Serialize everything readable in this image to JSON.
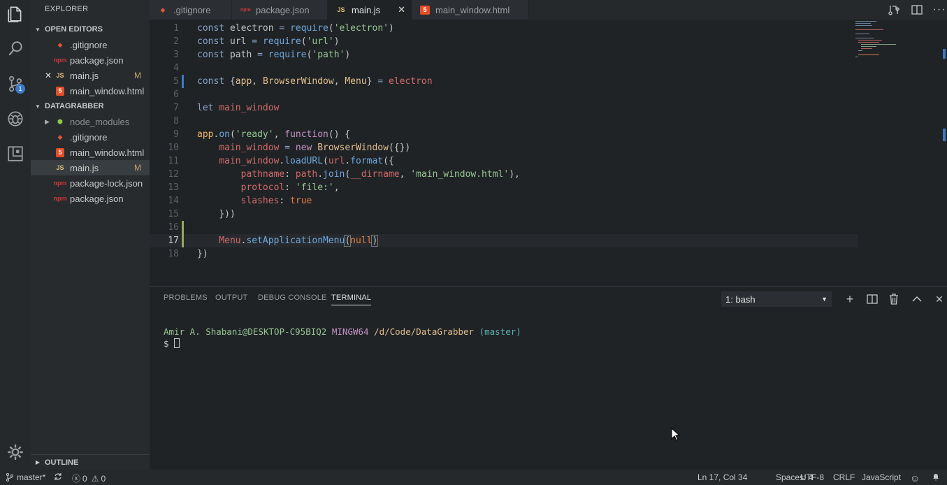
{
  "activity": {
    "items": [
      "files-icon",
      "search-icon",
      "source-control-icon",
      "debug-icon",
      "extensions-icon"
    ],
    "scm_badge": "1",
    "settings": "gear-icon"
  },
  "explorer": {
    "title": "EXPLORER",
    "open_editors": {
      "label": "OPEN EDITORS",
      "items": [
        {
          "name": ".gitignore",
          "icon": "git",
          "modified": ""
        },
        {
          "name": "package.json",
          "icon": "npm",
          "modified": ""
        },
        {
          "name": "main.js",
          "icon": "js",
          "modified": "M"
        },
        {
          "name": "main_window.html",
          "icon": "html",
          "modified": ""
        }
      ]
    },
    "project": {
      "label": "DATAGRABBER",
      "items": [
        {
          "name": "node_modules",
          "icon": "node",
          "modified": ""
        },
        {
          "name": ".gitignore",
          "icon": "git",
          "modified": ""
        },
        {
          "name": "main_window.html",
          "icon": "html",
          "modified": ""
        },
        {
          "name": "main.js",
          "icon": "js",
          "modified": "M"
        },
        {
          "name": "package-lock.json",
          "icon": "npm",
          "modified": ""
        },
        {
          "name": "package.json",
          "icon": "npm",
          "modified": ""
        }
      ]
    },
    "outline_label": "OUTLINE"
  },
  "tabs": [
    {
      "label": ".gitignore",
      "icon": "git"
    },
    {
      "label": "package.json",
      "icon": "npm"
    },
    {
      "label": "main.js",
      "icon": "js",
      "active": true
    },
    {
      "label": "main_window.html",
      "icon": "html"
    }
  ],
  "tab_icons": {
    "js": "JS",
    "git": "◆",
    "npm": "npm",
    "html": "5"
  },
  "editor": {
    "line_numbers": [
      "1",
      "2",
      "3",
      "4",
      "5",
      "6",
      "7",
      "8",
      "9",
      "10",
      "11",
      "12",
      "13",
      "14",
      "15",
      "16",
      "17",
      "18"
    ]
  },
  "panel": {
    "tabs": [
      "PROBLEMS",
      "OUTPUT",
      "DEBUG CONSOLE",
      "TERMINAL"
    ],
    "active_tab": "TERMINAL",
    "terminal_select": "1: bash",
    "prompt": {
      "user": "Amir A. Shabani@DESKTOP-C95BIQ2",
      "system": "MINGW64",
      "path": "/d/Code/DataGrabber",
      "branch": "(master)",
      "symbol": "$"
    }
  },
  "status": {
    "branch": "master*",
    "errors": "0",
    "warnings": "0",
    "position": "Ln 17, Col 34",
    "spaces": "Spaces: 4",
    "encoding": "UTF-8",
    "eol": "CRLF",
    "language": "JavaScript"
  },
  "colors": {
    "accent": "#3d79c9",
    "modified": "#c4a16a",
    "background": "#1f2326"
  }
}
